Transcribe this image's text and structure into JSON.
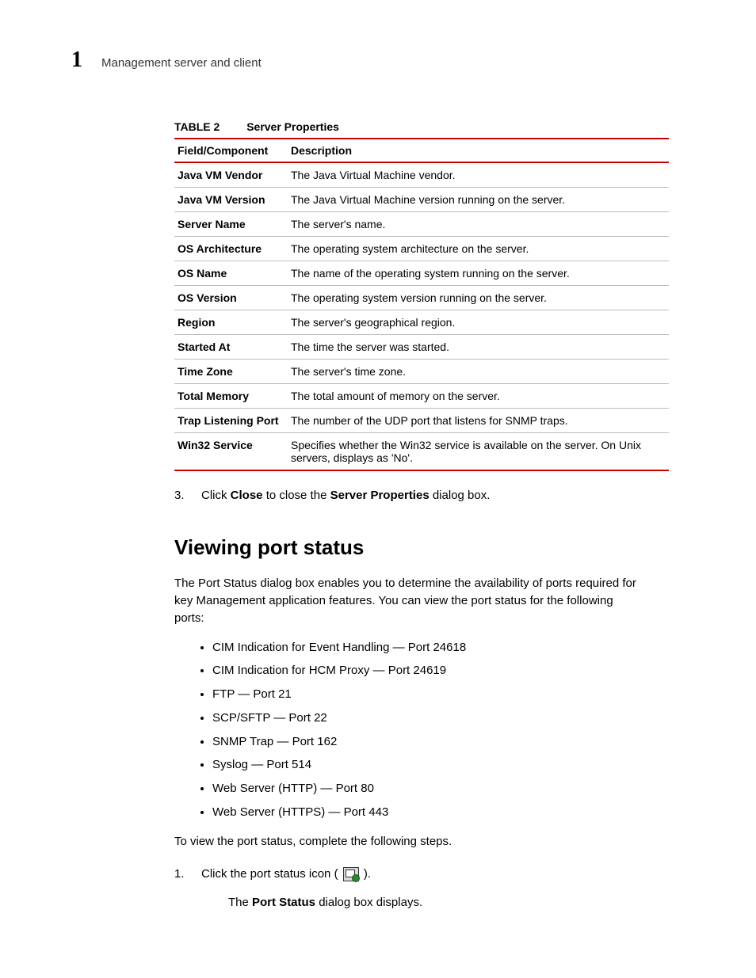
{
  "header": {
    "chapter_num": "1",
    "chapter_title": "Management server and client"
  },
  "table": {
    "caption_label": "TABLE 2",
    "caption_title": "Server Properties",
    "col1": "Field/Component",
    "col2": "Description",
    "rows": [
      {
        "f": "Java VM Vendor",
        "d": "The Java Virtual Machine vendor."
      },
      {
        "f": "Java VM Version",
        "d": "The Java Virtual Machine version running on the server."
      },
      {
        "f": "Server Name",
        "d": "The server's name."
      },
      {
        "f": "OS Architecture",
        "d": "The operating system architecture on the server."
      },
      {
        "f": "OS Name",
        "d": "The name of the operating system running on the server."
      },
      {
        "f": "OS Version",
        "d": "The operating system version running on the server."
      },
      {
        "f": "Region",
        "d": "The server's geographical region."
      },
      {
        "f": "Started At",
        "d": "The time the server was started."
      },
      {
        "f": "Time Zone",
        "d": "The server's time zone."
      },
      {
        "f": "Total Memory",
        "d": "The total amount of memory on the server."
      },
      {
        "f": "Trap Listening Port",
        "d": "The number of the UDP port that listens for SNMP traps."
      },
      {
        "f": "Win32 Service",
        "d": "Specifies whether the Win32 service is available on the server. On Unix servers, displays as 'No'."
      }
    ]
  },
  "step3": {
    "num": "3.",
    "prefix": "Click ",
    "close": "Close",
    "mid": " to close the ",
    "dlg": "Server Properties",
    "suffix": " dialog box."
  },
  "section_heading": "Viewing port status",
  "intro": "The Port Status dialog box enables you to determine the availability of ports required for key Management application features. You can view the port status for the following ports:",
  "ports": [
    "CIM Indication for Event Handling — Port 24618",
    "CIM Indication for HCM Proxy — Port 24619",
    "FTP — Port 21",
    "SCP/SFTP — Port 22",
    "SNMP Trap — Port 162",
    "Syslog — Port 514",
    "Web Server (HTTP) — Port 80",
    "Web Server (HTTPS) — Port 443"
  ],
  "outro": "To view the port status, complete the following steps.",
  "step1": {
    "num": "1.",
    "prefix": "Click the port status icon ( ",
    "suffix": " ).",
    "sub_prefix": "The ",
    "sub_bold": "Port Status",
    "sub_suffix": " dialog box displays."
  }
}
